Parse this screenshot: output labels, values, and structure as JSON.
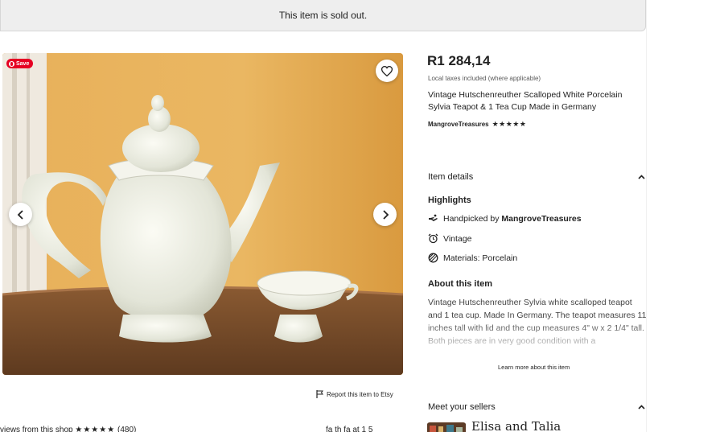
{
  "banner": {
    "text": "This item is sold out."
  },
  "gallery": {
    "save_label": "Save",
    "icons": {
      "favorite": "heart-icon",
      "prev": "chevron-left-icon",
      "next": "chevron-right-icon"
    }
  },
  "report": {
    "label": "Report this item to Etsy",
    "icon": "flag-icon"
  },
  "listing": {
    "price": "R1 284,14",
    "tax_note": "Local taxes included (where applicable)",
    "title": "Vintage Hutschenreuther Scalloped White Porcelain Sylvia Teapot & 1 Tea Cup Made in Germany",
    "shop_name": "MangroveTreasures",
    "shop_stars": "★★★★★"
  },
  "item_details": {
    "heading": "Item details",
    "highlights_heading": "Highlights",
    "highlights": [
      {
        "icon": "hand-icon",
        "prefix": "Handpicked by ",
        "bold": "MangroveTreasures"
      },
      {
        "icon": "alarm-clock-icon",
        "prefix": "Vintage",
        "bold": ""
      },
      {
        "icon": "materials-icon",
        "prefix": "Materials: Porcelain",
        "bold": ""
      }
    ],
    "about_heading": "About this item",
    "about_text": "Vintage Hutschenreuther Sylvia white scalloped teapot and 1 tea cup. Made In Germany. The teapot measures 11 inches tall with lid and the cup measures 4\" w x 2 1/4\" tall. Both pieces are in very good condition with a",
    "learn_more": "Learn more about this item"
  },
  "sellers": {
    "heading": "Meet your sellers",
    "name": "Elisa and Talia"
  },
  "reviews": {
    "text": "views from this shop",
    "stars": "★★★★★",
    "count": "(480)",
    "right_text": "fa th fa at 1 5"
  },
  "colors": {
    "banner_bg": "#eeeeee",
    "pinterest_red": "#e60023",
    "wall": "#e9b25c"
  }
}
